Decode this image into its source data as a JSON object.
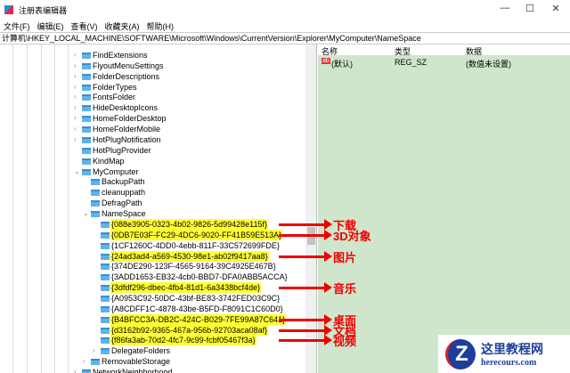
{
  "window": {
    "title": "注册表编辑器",
    "minimize": "—",
    "maximize": "☐",
    "close": "✕"
  },
  "menu": [
    "文件(F)",
    "编辑(E)",
    "查看(V)",
    "收藏夹(A)",
    "帮助(H)"
  ],
  "address": "计算机\\HKEY_LOCAL_MACHINE\\SOFTWARE\\Microsoft\\Windows\\CurrentVersion\\Explorer\\MyComputer\\NameSpace",
  "tree": [
    {
      "label": "FindExtensions",
      "level": 0,
      "chev": "›"
    },
    {
      "label": "FlyoutMenuSettings",
      "level": 0,
      "chev": "›"
    },
    {
      "label": "FolderDescriptions",
      "level": 0,
      "chev": "›"
    },
    {
      "label": "FolderTypes",
      "level": 0,
      "chev": "›"
    },
    {
      "label": "FontsFolder",
      "level": 0,
      "chev": "›"
    },
    {
      "label": "HideDesktopIcons",
      "level": 0,
      "chev": "›"
    },
    {
      "label": "HomeFolderDesktop",
      "level": 0,
      "chev": "›"
    },
    {
      "label": "HomeFolderMobile",
      "level": 0,
      "chev": "›"
    },
    {
      "label": "HotPlugNotification",
      "level": 0,
      "chev": "›"
    },
    {
      "label": "HotPlugProvider",
      "level": 0,
      "chev": ""
    },
    {
      "label": "KindMap",
      "level": 0,
      "chev": ""
    },
    {
      "label": "MyComputer",
      "level": 0,
      "chev": "⌄"
    },
    {
      "label": "BackupPath",
      "level": 1,
      "chev": ""
    },
    {
      "label": "cleanuppath",
      "level": 1,
      "chev": ""
    },
    {
      "label": "DefragPath",
      "level": 1,
      "chev": ""
    },
    {
      "label": "NameSpace",
      "level": 1,
      "chev": "⌄",
      "selected": true
    },
    {
      "label": "{088e3905-0323-4b02-9826-5d99428e115f}",
      "level": 2,
      "chev": "",
      "hl": true,
      "note": "下载"
    },
    {
      "label": "{0DB7E03F-FC29-4DC6-9020-FF41B59E513A}",
      "level": 2,
      "chev": "",
      "hl": true,
      "note": "3D对象"
    },
    {
      "label": "{1CF1260C-4DD0-4ebb-811F-33C572699FDE}",
      "level": 2,
      "chev": ""
    },
    {
      "label": "{24ad3ad4-a569-4530-98e1-ab02f9417aa8}",
      "level": 2,
      "chev": "",
      "hl": true,
      "note": "图片"
    },
    {
      "label": "{374DE290-123F-4565-9164-39C4925E467B}",
      "level": 2,
      "chev": ""
    },
    {
      "label": "{3ADD1653-EB32-4cb0-BBD7-DFA0ABB5ACCA}",
      "level": 2,
      "chev": ""
    },
    {
      "label": "{3dfdf296-dbec-4fb4-81d1-6a3438bcf4de}",
      "level": 2,
      "chev": "",
      "hl": true,
      "note": "音乐"
    },
    {
      "label": "{A0953C92-50DC-43bf-BE83-3742FED03C9C}",
      "level": 2,
      "chev": ""
    },
    {
      "label": "{A8CDFF1C-4878-43be-B5FD-F8091C1C60D0}",
      "level": 2,
      "chev": ""
    },
    {
      "label": "{B4BFCC3A-DB2C-424C-B029-7FE99A87C641}",
      "level": 2,
      "chev": "",
      "hl": true,
      "note": "桌面"
    },
    {
      "label": "{d3162b92-9365-467a-956b-92703aca08af}",
      "level": 2,
      "chev": "",
      "hl": true,
      "note": "文档"
    },
    {
      "label": "{f86fa3ab-70d2-4fc7-9c99-fcbf05467f3a}",
      "level": 2,
      "chev": "",
      "hl": true,
      "note": "视频"
    },
    {
      "label": "DelegateFolders",
      "level": 2,
      "chev": "›"
    },
    {
      "label": "RemovableStorage",
      "level": 1,
      "chev": "›"
    },
    {
      "label": "NetworkNeighborhood",
      "level": 0,
      "chev": "›"
    }
  ],
  "list": {
    "headers": [
      "名称",
      "类型",
      "数据"
    ],
    "row": {
      "icon": "ab",
      "name": "(默认)",
      "type": "REG_SZ",
      "data": "(数值未设置)"
    }
  },
  "logo": {
    "badge": "Z",
    "name": "这里教程网",
    "url": "herecours.com"
  },
  "colors": {
    "highlight": "#ffff33",
    "annotation": "#ee0000",
    "pane": "#cfe6cc"
  }
}
